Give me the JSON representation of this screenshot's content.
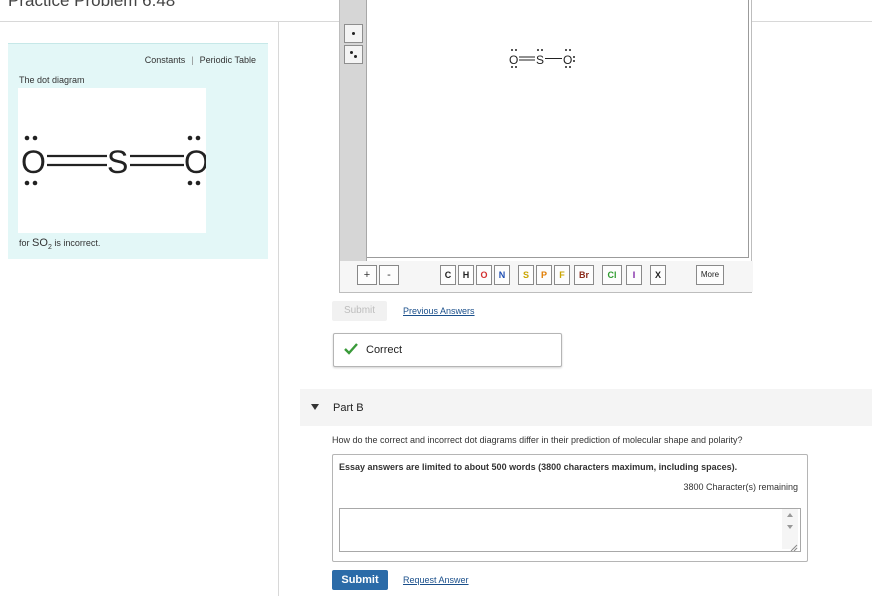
{
  "page": {
    "title": "Practice Problem 6.48"
  },
  "info_panel": {
    "links": {
      "constants": "Constants",
      "separator": "|",
      "periodic_table": "Periodic Table"
    },
    "intro": "The dot diagram",
    "diagram_atoms": [
      "O",
      "S",
      "O"
    ],
    "footer_prefix": "for",
    "formula_main": "SO",
    "formula_sub": "2",
    "footer_suffix": "is incorrect."
  },
  "drawing_tool": {
    "canvas_atoms": [
      "O",
      "S",
      "O"
    ],
    "charge_buttons": [
      "+",
      "-"
    ],
    "elements": [
      {
        "symbol": "C",
        "color": "#222222"
      },
      {
        "symbol": "H",
        "color": "#222222"
      },
      {
        "symbol": "O",
        "color": "#d32f2f"
      },
      {
        "symbol": "N",
        "color": "#1f4fb3"
      },
      {
        "symbol": "S",
        "color": "#c9a400"
      },
      {
        "symbol": "P",
        "color": "#e07b00"
      },
      {
        "symbol": "F",
        "color": "#c9a400"
      },
      {
        "symbol": "Br",
        "color": "#8b2a1a"
      },
      {
        "symbol": "Cl",
        "color": "#2e9b2e"
      },
      {
        "symbol": "I",
        "color": "#7a1fa2"
      },
      {
        "symbol": "X",
        "color": "#222222"
      }
    ],
    "more_label": "More"
  },
  "part_a": {
    "submit_label": "Submit",
    "previous_answers_label": "Previous Answers",
    "feedback": "Correct",
    "success_color": "#3a9a3a"
  },
  "part_b": {
    "label": "Part B",
    "question": "How do the correct and incorrect dot diagrams differ in their prediction of molecular shape and polarity?",
    "essay_limit": "Essay answers are limited to about 500 words (3800 characters maximum, including spaces).",
    "remaining": "3800 Character(s) remaining",
    "essay_value": "",
    "submit_label": "Submit",
    "request_answer_label": "Request Answer"
  }
}
